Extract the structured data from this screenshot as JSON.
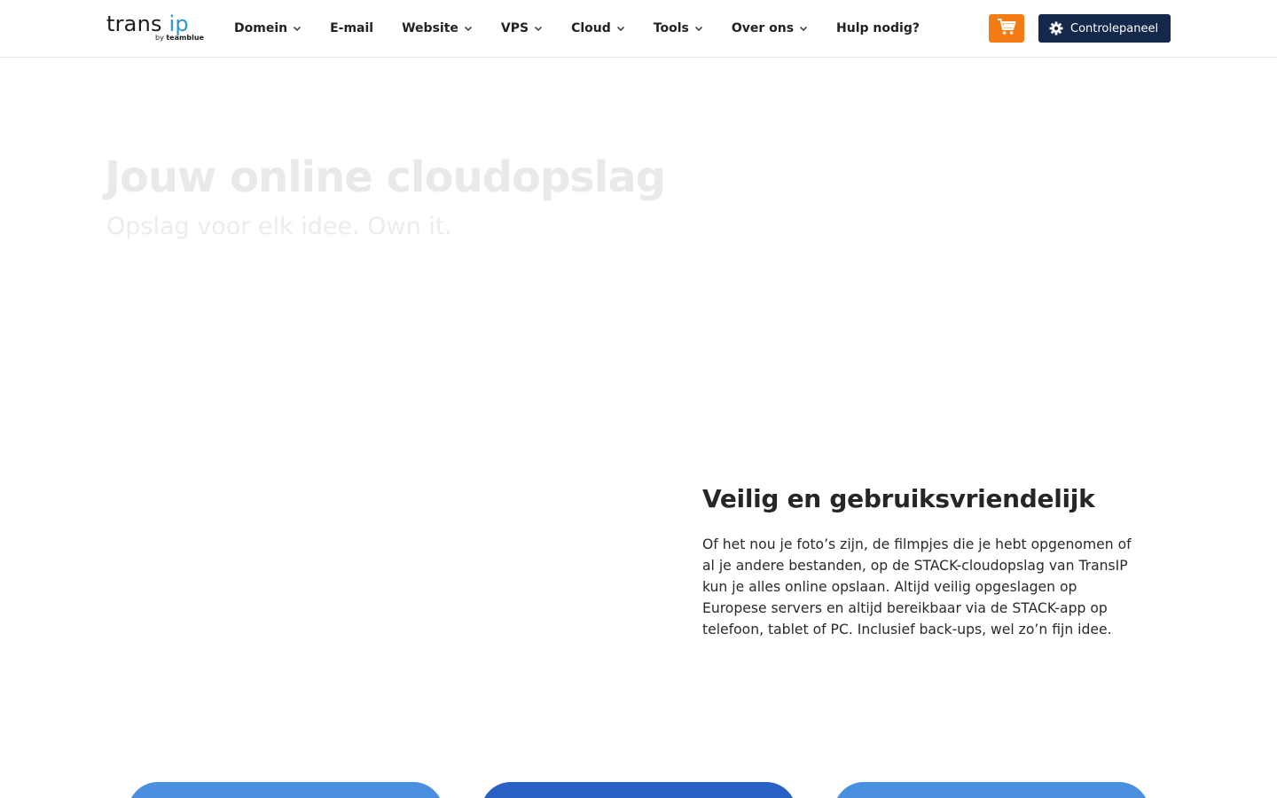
{
  "header": {
    "logo": {
      "brand_primary": "trans",
      "brand_accent": "ip",
      "tagline_prefix": "by",
      "tagline_company": "teamblue"
    },
    "nav": [
      {
        "label": "Domein",
        "has_dropdown": true
      },
      {
        "label": "E-mail",
        "has_dropdown": false
      },
      {
        "label": "Website",
        "has_dropdown": true
      },
      {
        "label": "VPS",
        "has_dropdown": true
      },
      {
        "label": "Cloud",
        "has_dropdown": true
      },
      {
        "label": "Tools",
        "has_dropdown": true
      },
      {
        "label": "Over ons",
        "has_dropdown": true
      },
      {
        "label": "Hulp nodig?",
        "has_dropdown": false
      }
    ],
    "cart_icon": "shopping-cart-icon",
    "control_panel": {
      "icon": "gear-icon",
      "label": "Controlepaneel"
    }
  },
  "hero": {
    "title": "Jouw online cloudopslag",
    "subtitle": "Opslag voor elk idee. Own it."
  },
  "feature": {
    "title": "Veilig en gebruiksvriendelijk",
    "text": "Of het nou je foto’s zijn, de filmpjes die je hebt opgenomen of al je andere bestanden, op de STACK-cloudopslag van TransIP kun je alles online opslaan. Altijd veilig opgeslagen op Europese servers en altijd bereikbaar via de STACK-app op telefoon, tablet of PC. Inclusief back-ups, wel zo’n fijn idee."
  },
  "colors": {
    "accent_orange": "#f57c15",
    "navy": "#14284b",
    "logo_blue": "#2d94d6",
    "card_light_blue": "#4a8fe0",
    "card_dark_blue": "#2860c4"
  }
}
